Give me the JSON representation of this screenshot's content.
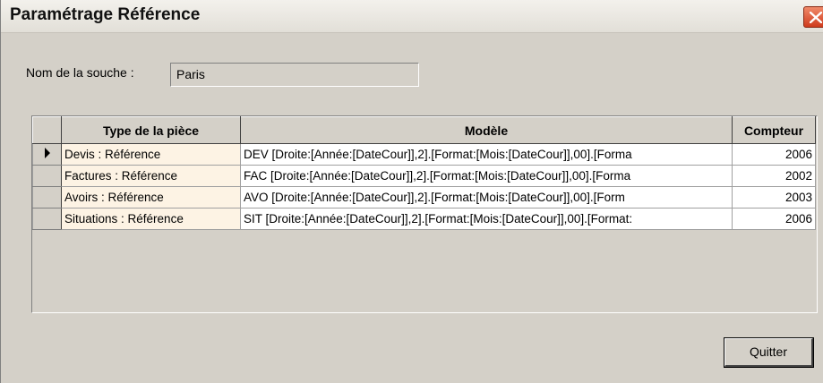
{
  "window": {
    "title": "Paramétrage Référence"
  },
  "souche": {
    "label": "Nom de la souche :",
    "value": "Paris"
  },
  "grid": {
    "columns": [
      "Type de la pièce",
      "Modèle",
      "Compteur"
    ],
    "rows": [
      {
        "type": "Devis : Référence",
        "modele": "DEV [Droite:[Année:[DateCour]],2].[Format:[Mois:[DateCour]],00].[Forma",
        "compteur": "2006",
        "current": true
      },
      {
        "type": "Factures : Référence",
        "modele": "FAC [Droite:[Année:[DateCour]],2].[Format:[Mois:[DateCour]],00].[Forma",
        "compteur": "2002",
        "current": false
      },
      {
        "type": "Avoirs : Référence",
        "modele": "AVO [Droite:[Année:[DateCour]],2].[Format:[Mois:[DateCour]],00].[Form",
        "compteur": "2003",
        "current": false
      },
      {
        "type": "Situations : Référence",
        "modele": "SIT [Droite:[Année:[DateCour]],2].[Format:[Mois:[DateCour]],00].[Format:",
        "compteur": "2006",
        "current": false
      }
    ]
  },
  "buttons": {
    "quit_label": "Quitter"
  },
  "colors": {
    "dialog_bg": "#d4d0c8",
    "type_cell_bg": "#fdf3e4",
    "close_red": "#cf3b1d"
  }
}
